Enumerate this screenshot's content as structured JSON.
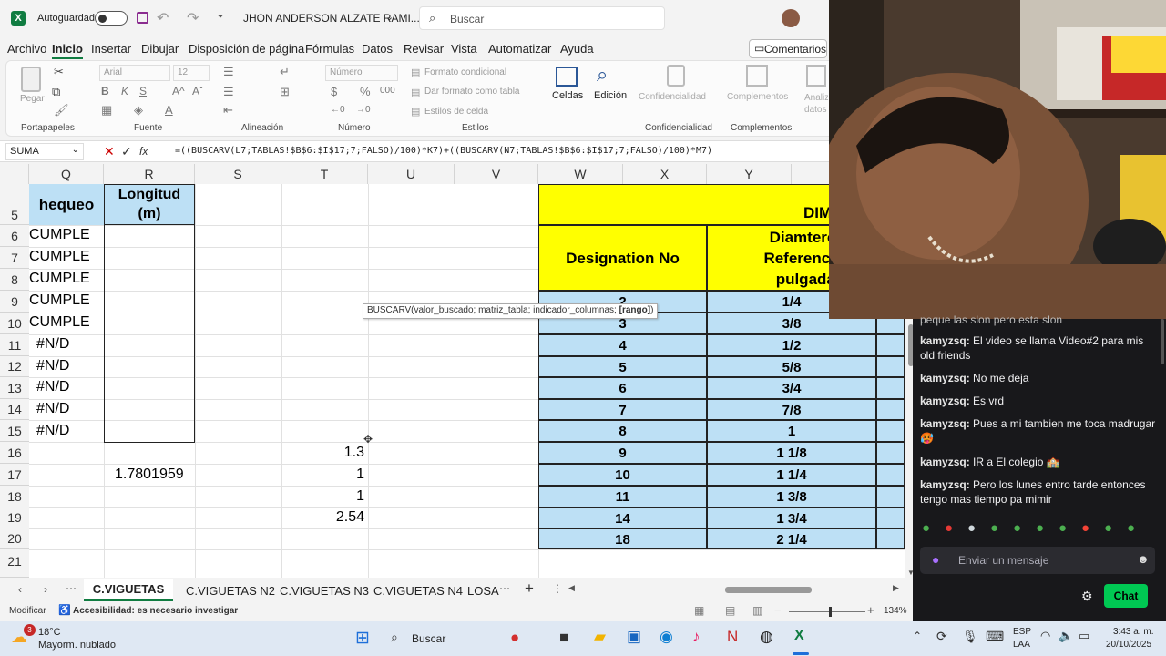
{
  "titlebar": {
    "autosave_label": "Autoguardado",
    "document_title": "JHON ANDERSON ALZATE RAMI...",
    "search_placeholder": "Buscar"
  },
  "ribbon_tabs": [
    "Archivo",
    "Inicio",
    "Insertar",
    "Dibujar",
    "Disposición de página",
    "Fórmulas",
    "Datos",
    "Revisar",
    "Vista",
    "Automatizar",
    "Ayuda"
  ],
  "comments_button": "Comentarios",
  "ribbon": {
    "paste_label": "Pegar",
    "font_name": "Arial",
    "font_size": "12",
    "number_format": "Número",
    "conditional_format": "Formato condicional",
    "format_as_table": "Dar formato como tabla",
    "cell_styles": "Estilos de celda",
    "cells_label": "Celdas",
    "editing_label": "Edición",
    "confidentiality_label": "Confidencialidad",
    "addins_label": "Complementos",
    "analyze_label": "Analizar datos",
    "group_labels": [
      "Portapapeles",
      "Fuente",
      "Alineación",
      "Número",
      "Estilos",
      "Confidencialidad",
      "Complementos"
    ]
  },
  "formula_bar": {
    "name_box": "SUMA",
    "fx": "fx",
    "formula": "=((BUSCARV(L7;TABLAS!$B$6:$I$17;7;FALSO)/100)*K7)+((BUSCARV(N7;TABLAS!$B$6:$I$17;7;FALSO)/100)*M7)"
  },
  "columns": [
    "Q",
    "R",
    "S",
    "T",
    "U",
    "V",
    "W",
    "X",
    "Y"
  ],
  "rows": [
    "5",
    "6",
    "7",
    "8",
    "9",
    "10",
    "11",
    "12",
    "13",
    "14",
    "15",
    "16",
    "17",
    "18",
    "19",
    "20",
    "21"
  ],
  "col_q_header": "hequeo",
  "col_r_header_1": "Longitud",
  "col_r_header_2": "(m)",
  "chequeo_values": [
    "CUMPLE",
    "CUMPLE",
    "CUMPLE",
    "CUMPLE",
    "CUMPLE",
    "#N/D",
    "#N/D",
    "#N/D",
    "#N/D",
    "#N/D"
  ],
  "r17_value": "1.7801959",
  "t_values": [
    "1.3",
    "1",
    "1",
    "2.54"
  ],
  "yellow_header": {
    "dim": "DIM",
    "designation": "Designation No",
    "diam_line1": "Diamtero d",
    "diam_line2": "Referencia c",
    "diam_line3": "pulgadas"
  },
  "designation_table": [
    {
      "no": "2",
      "diam": "1/4"
    },
    {
      "no": "3",
      "diam": "3/8"
    },
    {
      "no": "4",
      "diam": "1/2"
    },
    {
      "no": "5",
      "diam": "5/8"
    },
    {
      "no": "6",
      "diam": "3/4"
    },
    {
      "no": "7",
      "diam": "7/8"
    },
    {
      "no": "8",
      "diam": "1"
    },
    {
      "no": "9",
      "diam": "1 1/8"
    },
    {
      "no": "10",
      "diam": "1 1/4"
    },
    {
      "no": "11",
      "diam": "1 3/8"
    },
    {
      "no": "14",
      "diam": "1 3/4"
    },
    {
      "no": "18",
      "diam": "2 1/4"
    }
  ],
  "tooltip": {
    "text": "BUSCARV(valor_buscado; matriz_tabla; indicador_columnas; ",
    "bold": "[rango]",
    "end": ")"
  },
  "sheet_tabs": [
    "C.VIGUETAS N1",
    "C.VIGUETAS N2",
    "C.VIGUETAS N3",
    "C.VIGUETAS N4",
    "LOSA"
  ],
  "status": {
    "mode": "Modificar",
    "accessibility": "Accesibilidad: es necesario investigar",
    "zoom": "134%"
  },
  "chat": {
    "partial_top": "peque las slon pero esta slon",
    "messages": [
      {
        "user": "kamyzsq:",
        "text": "El video se llama Video#2 para mis old friends"
      },
      {
        "user": "kamyzsq:",
        "text": "No me deja"
      },
      {
        "user": "kamyzsq:",
        "text": "Es vrd"
      },
      {
        "user": "kamyzsq:",
        "text": "Pues a mi tambien me toca madrugar 🥵"
      },
      {
        "user": "kamyzsq:",
        "text": "IR a El colegio 🏫"
      },
      {
        "user": "kamyzsq:",
        "text": "Pero los lunes entro tarde entonces tengo mas tiempo pa mimir"
      }
    ],
    "input_placeholder": "Enviar un mensaje",
    "chat_button": "Chat"
  },
  "taskbar": {
    "weather_temp": "18°C",
    "weather_desc": "Mayorm. nublado",
    "weather_badge": "3",
    "search": "Buscar",
    "lang1": "ESP",
    "lang2": "LAA",
    "time": "3:43 a. m.",
    "date": "20/10/2025"
  },
  "colors": {
    "excel_green": "#107c41",
    "yellow": "#ffff00",
    "light_blue": "#bde0f5",
    "twitch_green": "#00c853"
  }
}
